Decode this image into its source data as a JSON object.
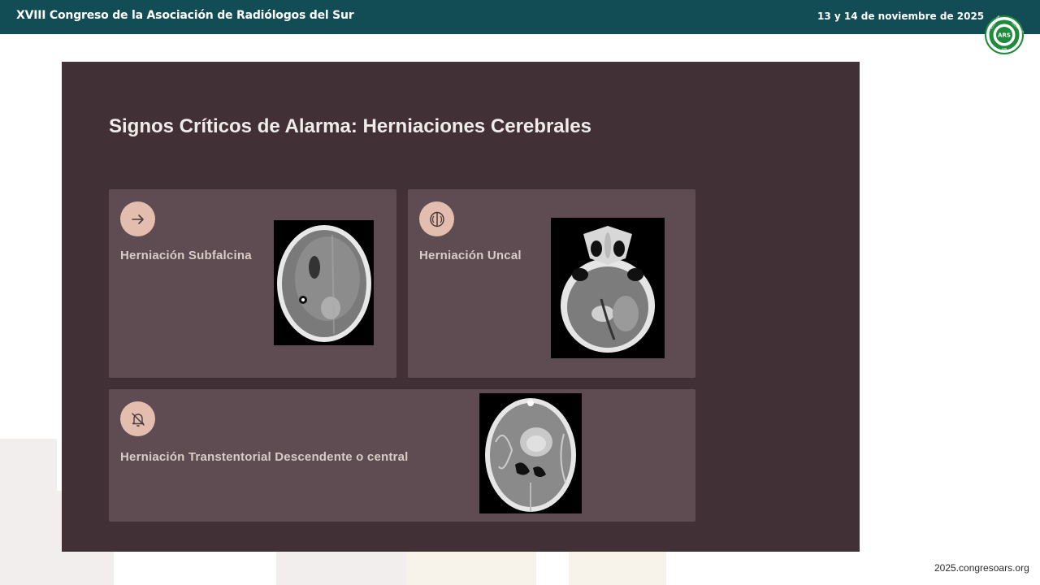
{
  "header": {
    "title": "XVIII Congreso de la Asociación de Radiólogos del Sur",
    "date": "13 y 14 de noviembre de 2025"
  },
  "logo": {
    "initials": "ARS",
    "ring_text_top": "RADIÓLOGOS",
    "ring_text_left": "ASOCIACIÓN",
    "ring_text_bottom": "SUR",
    "icon": "ars-seal-logo",
    "color": "#1d8a3c"
  },
  "slide": {
    "title": "Signos Críticos de Alarma: Herniaciones Cerebrales",
    "cards": [
      {
        "label": "Herniación Subfalcina",
        "icon": "arrow-right-icon"
      },
      {
        "label": "Herniación Uncal",
        "icon": "brain-icon"
      },
      {
        "label": "Herniación Transtentorial Descendente o central",
        "icon": "bell-off-icon"
      }
    ]
  },
  "footer": {
    "url": "2025.congresoars.org"
  },
  "colors": {
    "header_bg": "#124c55",
    "slide_bg": "#413036",
    "card_bg": "#5e4c52",
    "icon_circle": "#e3bdae"
  }
}
